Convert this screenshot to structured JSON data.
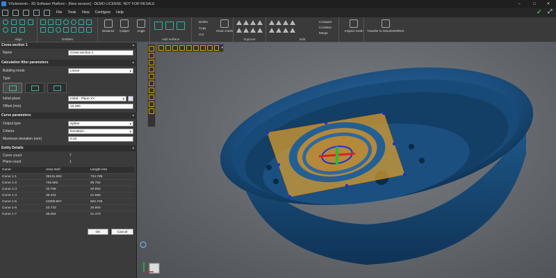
{
  "title": "VXelements - 3D Software Platform - [New session] - DEMO LICENSE: NOT FOR RESALE",
  "menu": [
    "File",
    "Tools",
    "View",
    "Configure",
    "Help"
  ],
  "ribbon": {
    "align_label": "Align",
    "entities_label": "Entities",
    "distance_label": "Distance",
    "caliper_label": "Caliper",
    "angle_label": "Angle",
    "add_surface_label": "Add surface",
    "delete_label": "Delete",
    "copy_label": "Copy",
    "cut_label": "Cut",
    "clean_mesh_label": "Clean mesh",
    "improve_label": "Improve",
    "compare_label": "Compare",
    "combine_label": "Combine",
    "merge_label": "Merge",
    "edit_label": "Edit",
    "inspect_mesh_label": "Inspect mesh",
    "transfer_label": "Transfer to SOLIDWORKS"
  },
  "panel": {
    "section1_title": "Cross-section 1",
    "name_label": "Name",
    "name_value": "Cross-section 1",
    "calc_title": "Calculation filter parameters",
    "building_mode_label": "Building mode",
    "building_mode_value": "Linear",
    "type_label": "Type",
    "initial_plane_label": "Initial plane",
    "initial_plane_value": "Initial - Plane XY",
    "offset_label": "Offset (mm)",
    "offset_value": "16.390",
    "curve_title": "Curve parameters",
    "output_type_label": "Output type",
    "output_type_value": "Spline",
    "criteria_label": "Criteria",
    "criteria_value": "Deviation",
    "max_dev_label": "Maximum deviation (mm)",
    "max_dev_value": "0.10",
    "entity_title": "Entity Details",
    "curve_count_label": "Curve count",
    "curve_count_value": "7",
    "plane_count_label": "Plane count",
    "plane_count_value": "1",
    "table_headers": [
      "Curve",
      "Area mm²",
      "Length mm"
    ],
    "table_rows": [
      [
        "Curve 1-1",
        "39131.883",
        "734.788"
      ],
      [
        "Curve 1-2",
        "725.582",
        "95.752"
      ],
      [
        "Curve 1-3",
        "33.756",
        "20.882"
      ],
      [
        "Curve 1-4",
        "36.422",
        "21.566"
      ],
      [
        "Curve 1-5",
        "22908.857",
        "602.728"
      ],
      [
        "Curve 1-6",
        "33.733",
        "20.893"
      ],
      [
        "Curve 1-7",
        "36.054",
        "21.470"
      ]
    ],
    "ok_label": "OK",
    "cancel_label": "Cancel"
  },
  "colors": {
    "model": "#1f5a8a",
    "plane": "#e6a22a",
    "accent": "#3fbf5f"
  }
}
